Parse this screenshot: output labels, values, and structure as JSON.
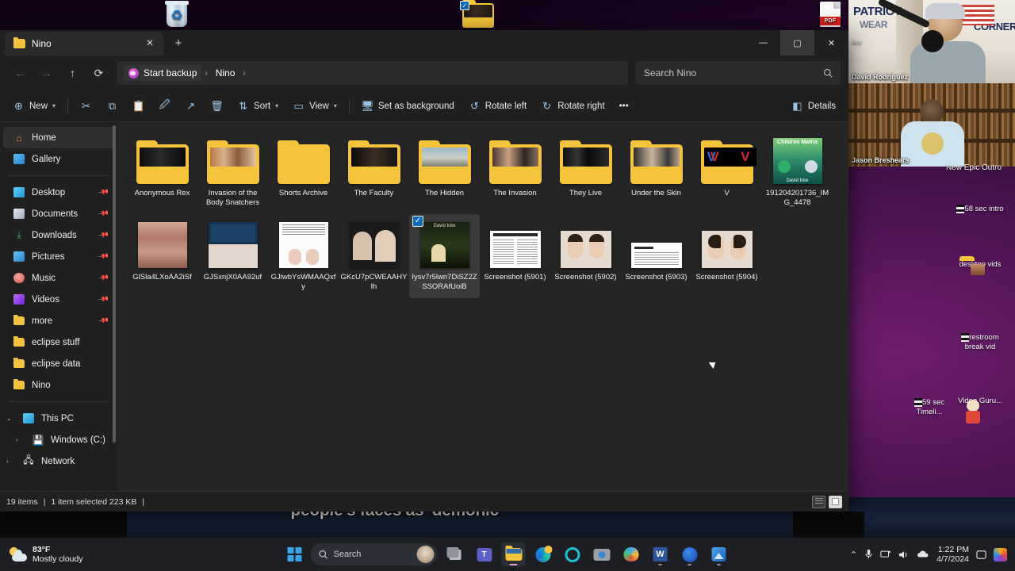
{
  "desktop": {
    "top_icons": [
      {
        "name": "recycle-bin",
        "label": ""
      },
      {
        "name": "selected-folder",
        "label": ""
      },
      {
        "name": "pdf-file",
        "label": ""
      }
    ],
    "right_icons": [
      {
        "label": "58 sec intro",
        "type": "video"
      },
      {
        "label": "desktop vids",
        "type": "folder"
      },
      {
        "label": "restroom break vid",
        "type": "video"
      },
      {
        "label": "59 sec Timeli...",
        "type": "video"
      },
      {
        "label": "Video.Guru...",
        "type": "app"
      }
    ]
  },
  "video_overlay": {
    "brand_left": "PATRIOT",
    "brand_left2": "WEAR",
    "brand_right": "CORNER",
    "brand_right_prefix": "S",
    "arc_label": "Arc",
    "participant_top": "David Rodriguez",
    "participant_bottom": "Jason Breshears",
    "epic_label": "New Epic Outro"
  },
  "caption": {
    "text": "people's faces as 'demonic'"
  },
  "explorer": {
    "tab": {
      "title": "Nino",
      "close_label": "✕"
    },
    "newtab_label": "+",
    "window_controls": {
      "minimize": "—",
      "maximize": "▢",
      "close": "✕"
    },
    "nav": {
      "back": "←",
      "forward": "→",
      "up": "↑",
      "refresh": "⟳"
    },
    "breadcrumb": [
      {
        "label": "Start backup",
        "icon": "onedrive-icon"
      },
      {
        "label": "Nino",
        "icon": ""
      }
    ],
    "breadcrumb_separator": "›",
    "search": {
      "placeholder": "Search Nino",
      "icon": "search-icon"
    },
    "toolbar": {
      "new_label": "New",
      "cut_label": "Cut",
      "copy_label": "Copy",
      "paste_label": "Paste",
      "rename_label": "Rename",
      "share_label": "Share",
      "delete_label": "Delete",
      "sort_label": "Sort",
      "view_label": "View",
      "set_as_background_label": "Set as background",
      "rotate_left_label": "Rotate left",
      "rotate_right_label": "Rotate right",
      "more_label": "•••",
      "details_label": "Details"
    },
    "sidebar": [
      {
        "label": "Home",
        "icon": "home-icon",
        "selected": true,
        "pinned": false,
        "kind": "item"
      },
      {
        "label": "Gallery",
        "icon": "gallery-icon",
        "selected": false,
        "pinned": false,
        "kind": "item"
      },
      {
        "kind": "divider"
      },
      {
        "label": "Desktop",
        "icon": "desktop-icon",
        "pinned": true,
        "kind": "item",
        "color": "#2fb8e8"
      },
      {
        "label": "Documents",
        "icon": "documents-icon",
        "pinned": true,
        "kind": "item",
        "color": "#cfd8e3"
      },
      {
        "label": "Downloads",
        "icon": "downloads-icon",
        "pinned": true,
        "kind": "item",
        "color": "#3fbf6f"
      },
      {
        "label": "Pictures",
        "icon": "pictures-icon",
        "pinned": true,
        "kind": "item",
        "color": "#3a9fe0"
      },
      {
        "label": "Music",
        "icon": "music-icon",
        "pinned": true,
        "kind": "item",
        "color": "#e8736c"
      },
      {
        "label": "Videos",
        "icon": "videos-icon",
        "pinned": true,
        "kind": "item",
        "color": "#9a4ff0"
      },
      {
        "label": "more",
        "icon": "folder-icon",
        "pinned": true,
        "kind": "item"
      },
      {
        "label": "eclipse stuff",
        "icon": "folder-icon",
        "pinned": false,
        "kind": "item"
      },
      {
        "label": "eclipse data",
        "icon": "folder-icon",
        "pinned": false,
        "kind": "item"
      },
      {
        "label": "Nino",
        "icon": "folder-icon",
        "pinned": false,
        "kind": "item"
      },
      {
        "kind": "divider"
      },
      {
        "label": "This PC",
        "icon": "this-pc-icon",
        "kind": "tree",
        "expanded": true
      },
      {
        "label": "Windows (C:)",
        "icon": "drive-icon",
        "kind": "tree-child",
        "expanded": false
      },
      {
        "label": "Network",
        "icon": "network-icon",
        "kind": "tree",
        "expanded": false
      }
    ],
    "files": [
      {
        "name": "Anonymous Rex",
        "type": "folder",
        "selected": false
      },
      {
        "name": "Invasion of the Body Snatchers",
        "type": "folder",
        "selected": false
      },
      {
        "name": "Shorts Archive",
        "type": "folder-empty",
        "selected": false
      },
      {
        "name": "The Faculty",
        "type": "folder",
        "selected": false
      },
      {
        "name": "The Hidden",
        "type": "folder",
        "selected": false
      },
      {
        "name": "The Invasion",
        "type": "folder",
        "selected": false
      },
      {
        "name": "They Live",
        "type": "folder",
        "selected": false
      },
      {
        "name": "Under the Skin",
        "type": "folder",
        "selected": false
      },
      {
        "name": "V",
        "type": "folder",
        "selected": false
      },
      {
        "name": "191204201736_IMG_4478",
        "type": "image-book",
        "selected": false
      },
      {
        "name": "GlSla4LXoAA2iSf",
        "type": "image-faces",
        "selected": false
      },
      {
        "name": "GJSxnjX0AA92uf",
        "type": "image-article-blue",
        "selected": false
      },
      {
        "name": "GJiwbYsWMAAQxfy",
        "type": "image-article-white",
        "selected": false
      },
      {
        "name": "GKcU7pCWEAAHYlh",
        "type": "image-politicians",
        "selected": false
      },
      {
        "name": "Iysv7r5lwn7DiSZ2ZSSORAfUoiB",
        "type": "image-dark-book",
        "selected": true
      },
      {
        "name": "Screenshot (5901)",
        "type": "image-doc",
        "selected": false
      },
      {
        "name": "Screenshot (5902)",
        "type": "image-portrait",
        "selected": false
      },
      {
        "name": "Screenshot (5903)",
        "type": "image-doc2",
        "selected": false
      },
      {
        "name": "Screenshot (5904)",
        "type": "image-profile",
        "selected": false
      }
    ],
    "status": {
      "item_count": "19 items",
      "separator": "|",
      "selection": "1 item selected  223 KB",
      "trailing_separator": "|"
    },
    "view_toggles": [
      {
        "name": "list-view-toggle",
        "active": false
      },
      {
        "name": "details-view-toggle",
        "active": true
      }
    ]
  },
  "taskbar": {
    "weather": {
      "temp": "83°F",
      "condition": "Mostly cloudy"
    },
    "search_placeholder": "Search",
    "apps": [
      {
        "name": "task-view",
        "running": false
      },
      {
        "name": "teams",
        "running": false
      },
      {
        "name": "file-explorer",
        "running": true,
        "active": true
      },
      {
        "name": "edge",
        "running": false
      },
      {
        "name": "alexa",
        "running": false
      },
      {
        "name": "camera",
        "running": false
      },
      {
        "name": "paint",
        "running": false
      },
      {
        "name": "word",
        "running": true
      },
      {
        "name": "browser-blue",
        "running": true
      },
      {
        "name": "photos",
        "running": true
      }
    ],
    "tray": {
      "overflow": "⌃",
      "mic": "mic-icon",
      "network": "network-icon",
      "volume": "volume-icon",
      "onedrive": "onedrive-icon",
      "time": "1:22 PM",
      "date": "4/7/2024",
      "notification": "notification-icon",
      "store": "store-icon"
    }
  }
}
